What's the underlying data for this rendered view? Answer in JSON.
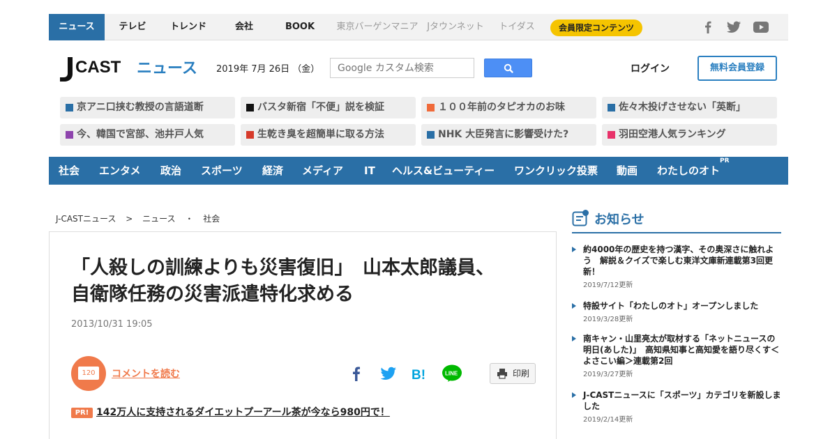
{
  "topnav": {
    "items": [
      {
        "label": "ニュース"
      },
      {
        "label": "テレビ"
      },
      {
        "label": "トレンド"
      },
      {
        "label": "会社"
      },
      {
        "label": "BOOK"
      },
      {
        "label": "東京バーゲンマニア"
      },
      {
        "label": "Jタウンネット"
      },
      {
        "label": "トイダス"
      }
    ],
    "member_pill": "会員限定コンテンツ",
    "social_icons": [
      "facebook-icon",
      "twitter-icon",
      "youtube-icon"
    ]
  },
  "header": {
    "logo_left": "J",
    "logo_cast": "CAST",
    "logo_news": "ニュース",
    "date": "2019年 7月 26日 （金）",
    "search_placeholder": "Google カスタム検索",
    "login": "ログイン",
    "register": "無料会員登録"
  },
  "trending": [
    {
      "label": "京アニ口挟む教授の言語道断",
      "color": "#2a6fa6"
    },
    {
      "label": "バスタ新宿「不便」説を検証",
      "color": "#111111"
    },
    {
      "label": "１００年前のタピオカのお味",
      "color": "#f06a3a"
    },
    {
      "label": "佐々木投げさせない「英断」",
      "color": "#2a6fa6"
    },
    {
      "label": "今、韓国で宮部、池井戸人気",
      "color": "#8e44ad"
    },
    {
      "label": "生乾き臭を超簡単に取る方法",
      "color": "#d63a2a"
    },
    {
      "label": "NHK 大臣発言に影響受けた?",
      "color": "#2a6fa6"
    },
    {
      "label": "羽田空港人気ランキング",
      "color": "#e8326a"
    }
  ],
  "categories": [
    "社会",
    "エンタメ",
    "政治",
    "スポーツ",
    "経済",
    "メディア",
    "IT",
    "ヘルス&ビューティー",
    "ワンクリック投票",
    "動画",
    "わたしのオト"
  ],
  "category_pr": "PR",
  "breadcrumb": [
    "J-CASTニュース",
    ">",
    "ニュース",
    "・",
    "社会"
  ],
  "article": {
    "headline_line1": "「人殺しの訓練よりも災害復旧」　山本太郎議員、",
    "headline_line2": "自衛隊任務の災害派遣特化求める",
    "date": "2013/10/31 19:05",
    "comment_count": "120",
    "comment_link": "コメントを読む",
    "print": "印刷",
    "pr_badge": "PR!",
    "pr_text": "142万人に支持されるダイエットプーアール茶が今なら980円で！"
  },
  "news": {
    "title": "お知らせ",
    "items": [
      {
        "title": "約4000年の歴史を持つ漢字、その奥深さに触れよう　解説＆クイズで楽しむ東洋文庫新連載第3回更新！",
        "date": "2019/7/12更新"
      },
      {
        "title": "特設サイト「わたしのオト」オープンしました",
        "date": "2019/3/28更新"
      },
      {
        "title": "南キャン・山里亮太が取材する「ネットニュースの明日(あした)」　高知県知事と高知愛を語り尽くす＜よさこい編＞連載第2回",
        "date": "2019/3/27更新"
      },
      {
        "title": "J-CASTニュースに「スポーツ」カテゴリを新設しました",
        "date": "2019/2/14更新"
      }
    ]
  }
}
